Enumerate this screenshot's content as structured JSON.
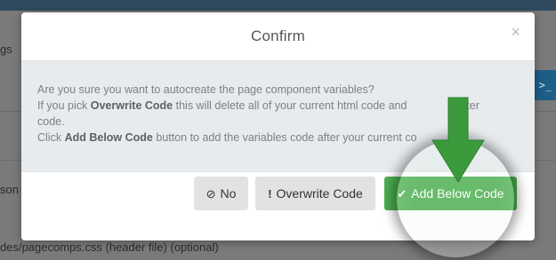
{
  "background": {
    "fragment_left_top": "gs",
    "fragment_left_mid": "son",
    "fragment_bottom": "des/pagecomps.css (header file) (optional)",
    "right_button_glyph": ">_"
  },
  "modal": {
    "title": "Confirm",
    "close_glyph": "×",
    "body": {
      "line1": "Are you sure you want to autocreate the page component variables?",
      "line2_prefix": "If you pick ",
      "line2_bold": "Overwrite Code",
      "line2_suffix": " this will delete all of your current html code and",
      "line2_tail": "starter",
      "line3": "code.",
      "line4_prefix": "Click ",
      "line4_bold": "Add Below Code",
      "line4_suffix": " button to add the variables code after your current co"
    },
    "buttons": {
      "no_label": "No",
      "no_icon": "⊘",
      "overwrite_label": "Overwrite Code",
      "overwrite_icon": "!",
      "add_label": "Add Below Code",
      "add_icon": "✔"
    }
  },
  "colors": {
    "primary_green": "#4caf50",
    "arrow_green": "#3a9a3c",
    "default_button": "#e2e2e2"
  }
}
